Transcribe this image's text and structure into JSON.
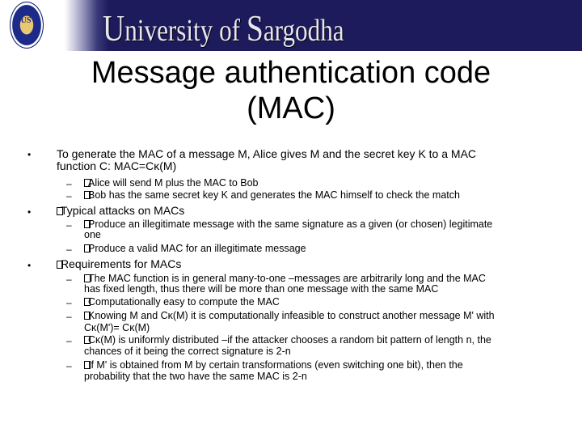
{
  "header": {
    "logo_text": "US",
    "university_name_cap1": "U",
    "university_name_part1": "niversity of ",
    "university_name_cap2": "S",
    "university_name_part2": "argodha",
    "background_color": "#1e1b5c"
  },
  "slide": {
    "title_line1": "Message authentication code",
    "title_line2": "(MAC)",
    "bullet_glyph": "•",
    "dash_glyph": "–",
    "items": [
      {
        "text_line1": "To generate the MAC of a message M, Alice gives M and the secret key K to a MAC",
        "text_line2": "function C: MAC=Cĸ(M)",
        "subitems": [
          {
            "text": "Alice will send M plus the MAC to Bob"
          },
          {
            "text": "Bob has the same secret key K and generates the MAC himself to check the match"
          }
        ]
      },
      {
        "text_line1": "Typical attacks on MACs",
        "subitems": [
          {
            "text_line1": "Produce an illegitimate message with the same signature as a given (or chosen) legitimate",
            "text_line2": "one"
          },
          {
            "text": "Produce a valid MAC for an illegitimate message"
          }
        ]
      },
      {
        "text_line1": "Requirements for MACs",
        "subitems": [
          {
            "text_line1": "The MAC function is in general many-to-one –messages are arbitrarily long and the MAC",
            "text_line2": "has fixed length, thus there will be more than one message with the same MAC"
          },
          {
            "text": "Computationally easy to compute the MAC"
          },
          {
            "text_line1": "Knowing M and Cĸ(M) it is computationally infeasible to construct another message M' with",
            "text_line2": "Cĸ(M')= Cĸ(M)"
          },
          {
            "text_line1": "Cĸ(M) is uniformly distributed –if the attacker chooses a random bit pattern of length n, the",
            "text_line2": "chances of it being the correct signature is 2-n"
          },
          {
            "text_line1": "If M' is obtained from M by certain transformations (even switching one bit), then the",
            "text_line2": "probability that the two have the same MAC is 2-n"
          }
        ]
      }
    ]
  }
}
